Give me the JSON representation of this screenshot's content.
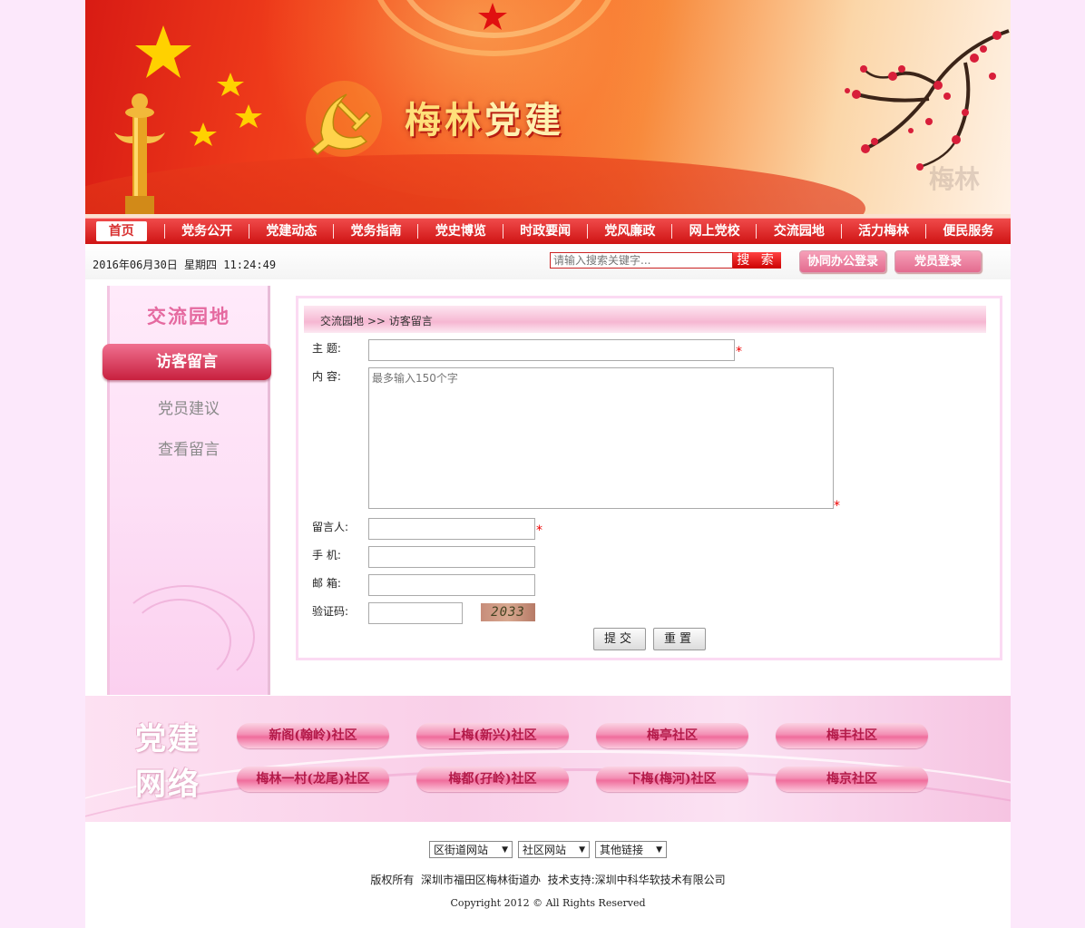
{
  "banner": {
    "name_part1": "梅林",
    "name_part2": "党建",
    "watermark": "梅林"
  },
  "nav": {
    "items": [
      "首页",
      "党务公开",
      "党建动态",
      "党务指南",
      "党史博览",
      "时政要闻",
      "党风廉政",
      "网上党校",
      "交流园地",
      "活力梅林",
      "便民服务"
    ],
    "active": "首页"
  },
  "toolbar": {
    "datetime": "2016年06月30日 星期四 11:24:49",
    "search_placeholder": "请输入搜索关键字...",
    "search_label": "搜 索",
    "oa_login_label": "协同办公登录",
    "member_login_label": "党员登录"
  },
  "sidebar": {
    "title": "交流园地",
    "active_item": "访客留言",
    "items": [
      "党员建议",
      "查看留言"
    ]
  },
  "content": {
    "breadcrumb": "交流园地 >> 访客留言",
    "form": {
      "subject_label": "主  题:",
      "content_label": "内  容:",
      "content_placeholder": "最多输入150个字",
      "author_label": "留言人:",
      "phone_label": "手  机:",
      "email_label": "邮  箱:",
      "captcha_label": "验证码:",
      "captcha_text": "2033",
      "required_mark": "*",
      "submit_label": "提交",
      "reset_label": "重置"
    }
  },
  "network": {
    "title_line1": "党建",
    "title_line2": "网络",
    "communities": [
      "新阁(翰岭)社区",
      "上梅(新兴)社区",
      "梅亭社区",
      "梅丰社区",
      "梅林一村(龙尾)社区",
      "梅都(孖岭)社区",
      "下梅(梅河)社区",
      "梅京社区"
    ]
  },
  "footer": {
    "selects": [
      "区街道网站",
      "社区网站",
      "其他链接"
    ],
    "info": "版权所有  深圳市福田区梅林街道办  技术支持:深圳中科华软技术有限公司",
    "copyright": "Copyright 2012 © All Rights Reserved"
  },
  "colors": {
    "brand_red": "#d81b14",
    "pink_accent": "#e56aa0",
    "background": "#fce8fb"
  }
}
